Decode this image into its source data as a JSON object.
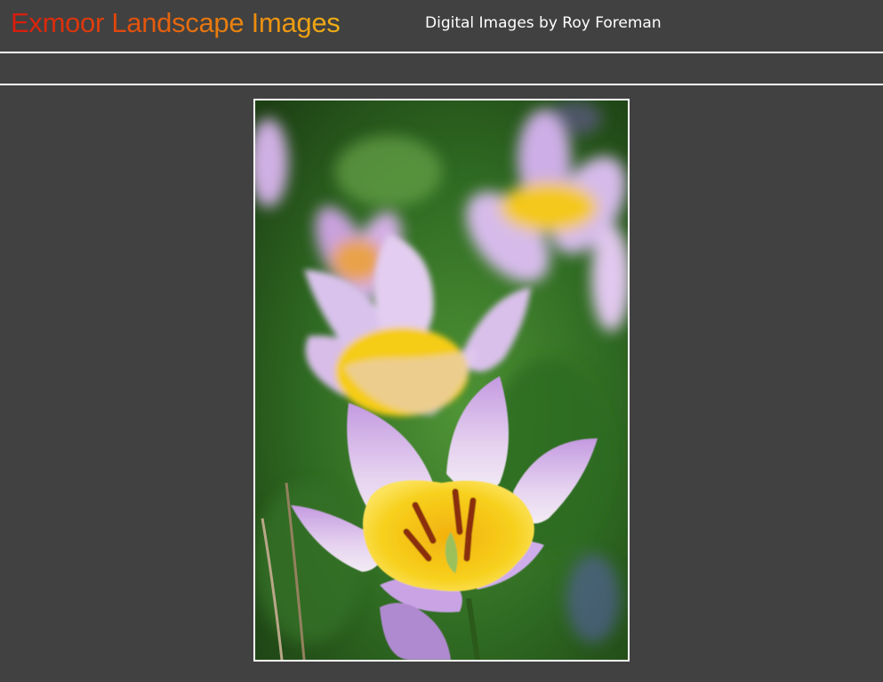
{
  "header": {
    "title": "Exmoor Landscape Images",
    "subtitle": "Digital Images by Roy Foreman"
  },
  "photo": {
    "subject": "purple-yellow-tulip-photo",
    "colors": {
      "background_green": "#3e7a2a",
      "petal": "#d8b6e8",
      "center": "#f4c81a",
      "stamen": "#7a2a0c"
    }
  },
  "theme": {
    "page_bg": "#414141",
    "rule": "#ffffff",
    "title_gradient": [
      "#d81a0c",
      "#f0b014"
    ]
  }
}
